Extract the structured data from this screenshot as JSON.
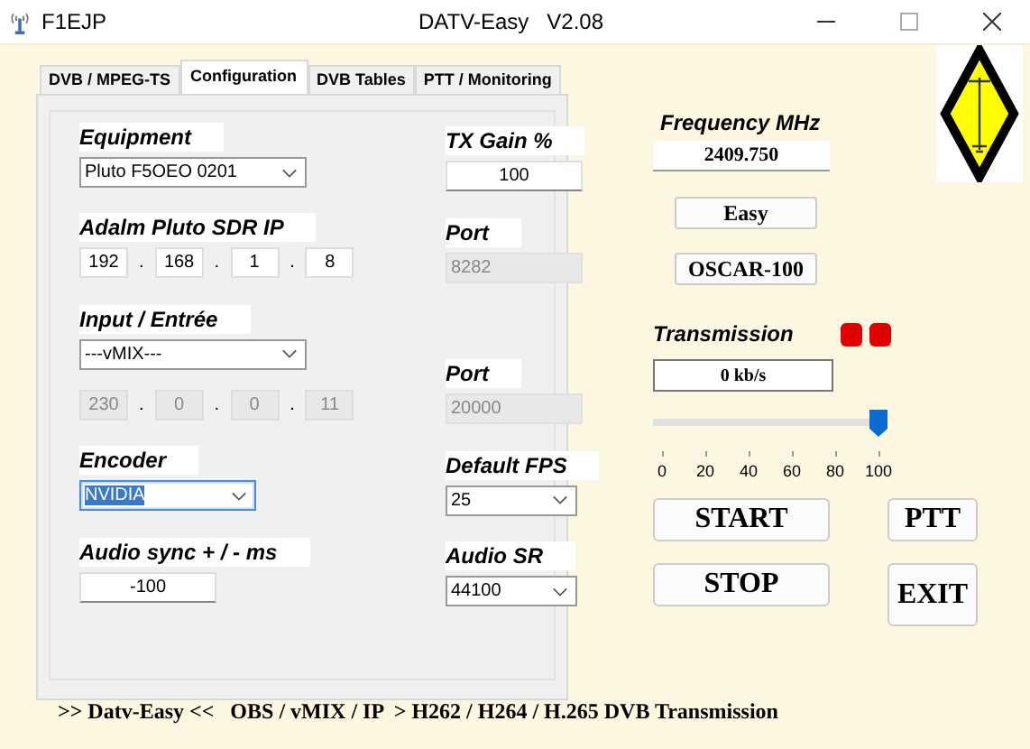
{
  "window": {
    "app_name": "F1EJP",
    "title": "DATV-Easy   V2.08"
  },
  "tabs": [
    {
      "label": "DVB / MPEG-TS",
      "selected": false
    },
    {
      "label": "Configuration",
      "selected": true
    },
    {
      "label": "DVB Tables",
      "selected": false
    },
    {
      "label": "PTT / Monitoring",
      "selected": false
    }
  ],
  "form": [
    {
      "label": "Equipment",
      "controls": [
        {
          "kind": "select",
          "value": "Pluto F5OEO 0201",
          "focused": false
        }
      ]
    },
    {
      "label": "TX Gain %",
      "controls": [
        {
          "kind": "text",
          "value": "100",
          "disabled": false
        }
      ]
    },
    {
      "label": "Adalm Pluto SDR IP",
      "controls": [
        {
          "kind": "ip",
          "parts": [
            "192",
            "168",
            "1",
            "8"
          ],
          "separator": ".",
          "disabled": false
        }
      ]
    },
    {
      "label": "Port",
      "controls": [
        {
          "kind": "text",
          "value": "8282",
          "disabled": true
        }
      ]
    },
    {
      "label": "Input / Entrée",
      "controls": [
        {
          "kind": "select",
          "value": "---vMIX---",
          "focused": false
        },
        {
          "kind": "ip",
          "parts": [
            "230",
            "0",
            "0",
            "11"
          ],
          "separator": ".",
          "disabled": true
        }
      ]
    },
    {
      "label": "Port",
      "controls": [
        {
          "kind": "text",
          "value": "20000",
          "disabled": true
        }
      ]
    },
    {
      "label": "Encoder",
      "controls": [
        {
          "kind": "select",
          "value": "NVIDIA",
          "focused": true
        }
      ]
    },
    {
      "label": "Default FPS",
      "controls": [
        {
          "kind": "select",
          "value": "25",
          "focused": false
        }
      ]
    },
    {
      "label": "Audio sync + / - ms",
      "controls": [
        {
          "kind": "text",
          "value": "-100",
          "disabled": false
        }
      ]
    },
    {
      "label": "Audio SR",
      "controls": [
        {
          "kind": "select",
          "value": "44100",
          "focused": false
        }
      ]
    }
  ],
  "frequency": {
    "label": "Frequency MHz",
    "value": "2409.750"
  },
  "mode_buttons": [
    "Easy",
    "OSCAR-100"
  ],
  "transmission": {
    "label": "Transmission",
    "leds": [
      {
        "color": "#e00000"
      },
      {
        "color": "#e00000"
      }
    ],
    "rate": "0 kb/s"
  },
  "slider": {
    "level": 1.0,
    "ticks": [
      "0",
      "20",
      "40",
      "60",
      "80",
      "100"
    ]
  },
  "action_buttons": [
    [
      "START",
      "PTT"
    ],
    [
      "STOP",
      "EXIT"
    ]
  ],
  "status_bar": ">> Datv-Easy <<   OBS / vMIX / IP  > H262 / H264 / H.265 DVB Transmission"
}
